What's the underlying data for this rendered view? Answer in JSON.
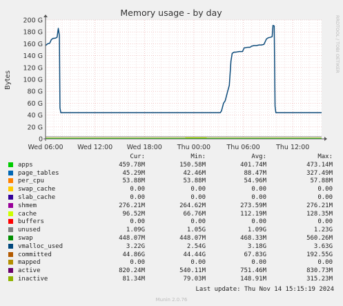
{
  "chart_data": {
    "type": "line",
    "title": "Memory usage - by day",
    "ylabel": "Bytes",
    "side_label": "RRDTOOL / TOBI OETIKER",
    "ylim": [
      0,
      200
    ],
    "y_ticks": [
      "0",
      "20 G",
      "40 G",
      "60 G",
      "80 G",
      "100 G",
      "120 G",
      "140 G",
      "160 G",
      "180 G",
      "200 G"
    ],
    "xlim": [
      0,
      33.5
    ],
    "x_ticks": [
      {
        "label": "Wed 06:00",
        "x": 0
      },
      {
        "label": "Wed 12:00",
        "x": 6
      },
      {
        "label": "Wed 18:00",
        "x": 12
      },
      {
        "label": "Thu 00:00",
        "x": 18
      },
      {
        "label": "Thu 06:00",
        "x": 24
      },
      {
        "label": "Thu 12:00",
        "x": 30
      }
    ],
    "grid": true,
    "series": [
      {
        "name": "committed",
        "color": "#0b4a7a",
        "points": [
          [
            0,
            157
          ],
          [
            0.25,
            160
          ],
          [
            0.5,
            161
          ],
          [
            0.7,
            167
          ],
          [
            0.9,
            169
          ],
          [
            1.2,
            169.5
          ],
          [
            1.4,
            171
          ],
          [
            1.55,
            186
          ],
          [
            1.68,
            174
          ],
          [
            1.75,
            52
          ],
          [
            1.85,
            44
          ],
          [
            2.2,
            44
          ],
          [
            8,
            44
          ],
          [
            14,
            44
          ],
          [
            20,
            44
          ],
          [
            21.2,
            44
          ],
          [
            21.35,
            47
          ],
          [
            21.6,
            60
          ],
          [
            21.8,
            64
          ],
          [
            22.1,
            80
          ],
          [
            22.3,
            90
          ],
          [
            22.5,
            131
          ],
          [
            22.65,
            144
          ],
          [
            22.9,
            146
          ],
          [
            23.1,
            146
          ],
          [
            23.5,
            147
          ],
          [
            23.9,
            147
          ],
          [
            24.1,
            153
          ],
          [
            24.5,
            154
          ],
          [
            24.8,
            154
          ],
          [
            25.0,
            156
          ],
          [
            25.3,
            157
          ],
          [
            25.6,
            157
          ],
          [
            25.9,
            158
          ],
          [
            26.2,
            158
          ],
          [
            26.5,
            159
          ],
          [
            26.8,
            168
          ],
          [
            27.0,
            170
          ],
          [
            27.3,
            171
          ],
          [
            27.5,
            172
          ],
          [
            27.6,
            191
          ],
          [
            27.75,
            190
          ],
          [
            27.85,
            55
          ],
          [
            27.95,
            44
          ],
          [
            28.5,
            44
          ],
          [
            31,
            44
          ],
          [
            33.5,
            44
          ]
        ]
      },
      {
        "name": "apps",
        "color": "#00cc00",
        "points": [
          [
            0,
            0.46
          ],
          [
            18,
            0.46
          ],
          [
            21.5,
            0.47
          ],
          [
            33.5,
            0.47
          ]
        ]
      },
      {
        "name": "vmalloc_used",
        "color": "#888888",
        "points": [
          [
            0,
            3.2
          ],
          [
            12,
            3.2
          ],
          [
            21.3,
            3.22
          ],
          [
            33.5,
            3.22
          ]
        ]
      },
      {
        "name": "unused",
        "color": "#ccff00",
        "points": [
          [
            0,
            1.1
          ],
          [
            17,
            1.1
          ],
          [
            17,
            2.0
          ],
          [
            19.5,
            2.0
          ],
          [
            19.5,
            1.1
          ],
          [
            33.5,
            1.1
          ]
        ]
      },
      {
        "name": "active",
        "color": "#cc9900",
        "points": [
          [
            0,
            0.8
          ],
          [
            33.5,
            0.8
          ]
        ]
      }
    ]
  },
  "legend": {
    "headers": [
      "Cur:",
      "Min:",
      "Avg:",
      "Max:"
    ],
    "rows": [
      {
        "name": "apps",
        "color": "#00cc00",
        "cur": "459.78M",
        "min": "150.58M",
        "avg": "401.74M",
        "max": "473.14M"
      },
      {
        "name": "page_tables",
        "color": "#0066b3",
        "cur": "45.29M",
        "min": "42.46M",
        "avg": "88.47M",
        "max": "327.49M"
      },
      {
        "name": "per_cpu",
        "color": "#ff8000",
        "cur": "53.88M",
        "min": "53.88M",
        "avg": "54.96M",
        "max": "57.88M"
      },
      {
        "name": "swap_cache",
        "color": "#ffcc00",
        "cur": "0.00",
        "min": "0.00",
        "avg": "0.00",
        "max": "0.00"
      },
      {
        "name": "slab_cache",
        "color": "#330099",
        "cur": "0.00",
        "min": "0.00",
        "avg": "0.00",
        "max": "0.00"
      },
      {
        "name": "shmem",
        "color": "#990099",
        "cur": "276.21M",
        "min": "264.62M",
        "avg": "273.59M",
        "max": "276.21M"
      },
      {
        "name": "cache",
        "color": "#ccff00",
        "cur": "96.52M",
        "min": "66.76M",
        "avg": "112.19M",
        "max": "128.35M"
      },
      {
        "name": "buffers",
        "color": "#ff0000",
        "cur": "0.00",
        "min": "0.00",
        "avg": "0.00",
        "max": "0.00"
      },
      {
        "name": "unused",
        "color": "#808080",
        "cur": "1.09G",
        "min": "1.05G",
        "avg": "1.09G",
        "max": "1.23G"
      },
      {
        "name": "swap",
        "color": "#008f00",
        "cur": "448.07M",
        "min": "448.07M",
        "avg": "468.33M",
        "max": "560.26M"
      },
      {
        "name": "vmalloc_used",
        "color": "#00487d",
        "cur": "3.22G",
        "min": "2.54G",
        "avg": "3.18G",
        "max": "3.63G"
      },
      {
        "name": "committed",
        "color": "#b35a00",
        "cur": "44.86G",
        "min": "44.44G",
        "avg": "67.83G",
        "max": "192.55G"
      },
      {
        "name": "mapped",
        "color": "#b38f00",
        "cur": "0.00",
        "min": "0.00",
        "avg": "0.00",
        "max": "0.00"
      },
      {
        "name": "active",
        "color": "#6b006b",
        "cur": "820.24M",
        "min": "540.11M",
        "avg": "751.46M",
        "max": "830.73M"
      },
      {
        "name": "inactive",
        "color": "#8fb300",
        "cur": "81.34M",
        "min": "79.03M",
        "avg": "148.91M",
        "max": "315.23M"
      }
    ]
  },
  "last_update": "Last update: Thu Nov 14 15:15:19 2024",
  "footer": "Munin 2.0.76"
}
